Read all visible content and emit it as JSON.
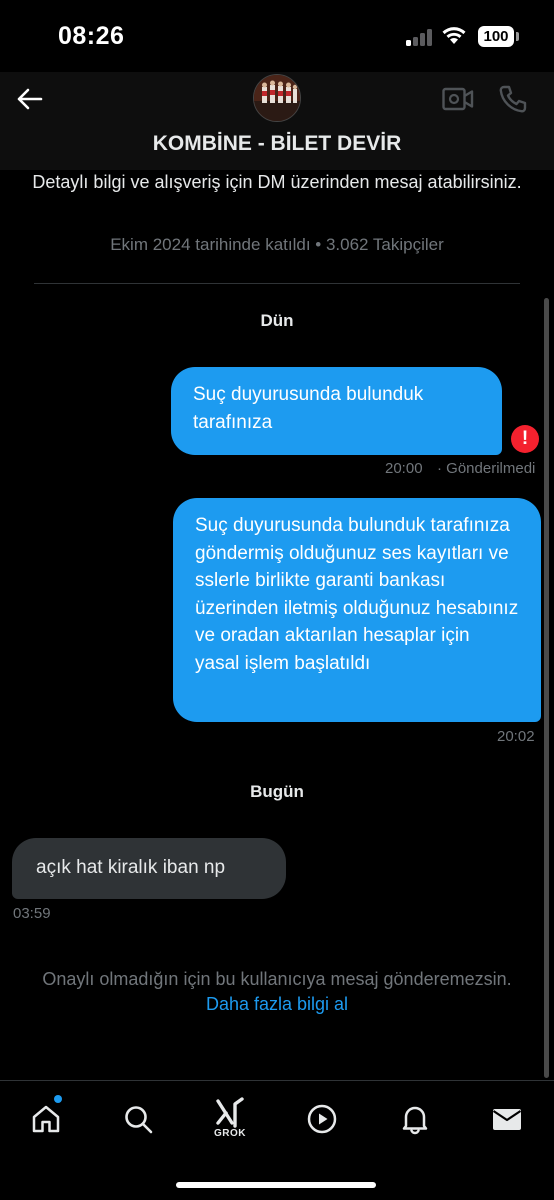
{
  "status_bar": {
    "time": "08:26",
    "battery": "100"
  },
  "header": {
    "title": "KOMBİNE - BİLET DEVİR"
  },
  "profile": {
    "bio": "Detaylı bilgi ve alışveriş için DM üzerinden mesaj atabilirsiniz.",
    "joined": "Ekim 2024 tarihinde katıldı • 3.062 Takipçiler"
  },
  "conversation": {
    "day1": "Dün",
    "msg1": {
      "text": "Suç duyurusunda bulunduk tarafınıza",
      "time": "20:00",
      "status": "· Gönderilmedi"
    },
    "msg2": {
      "text": "Suç duyurusunda bulunduk tarafınıza göndermiş olduğunuz ses kayıtları ve sslerle birlikte garanti bankası üzerinden iletmiş olduğunuz hesabınız ve oradan aktarılan hesaplar için yasal işlem başlatıldı",
      "time": "20:02"
    },
    "day2": "Bugün",
    "msg3": {
      "text": "açık hat kiralık iban np",
      "time": "03:59"
    }
  },
  "notice": {
    "text": "Onaylı olmadığın için bu kullanıcıya mesaj gönderemezsin.",
    "link": "Daha fazla bilgi al"
  },
  "bottom_nav": {
    "grok_label": "GROK"
  },
  "colors": {
    "accent": "#1d9bf0",
    "error": "#f4212e",
    "incoming": "#2f3336",
    "muted": "#71767b"
  }
}
